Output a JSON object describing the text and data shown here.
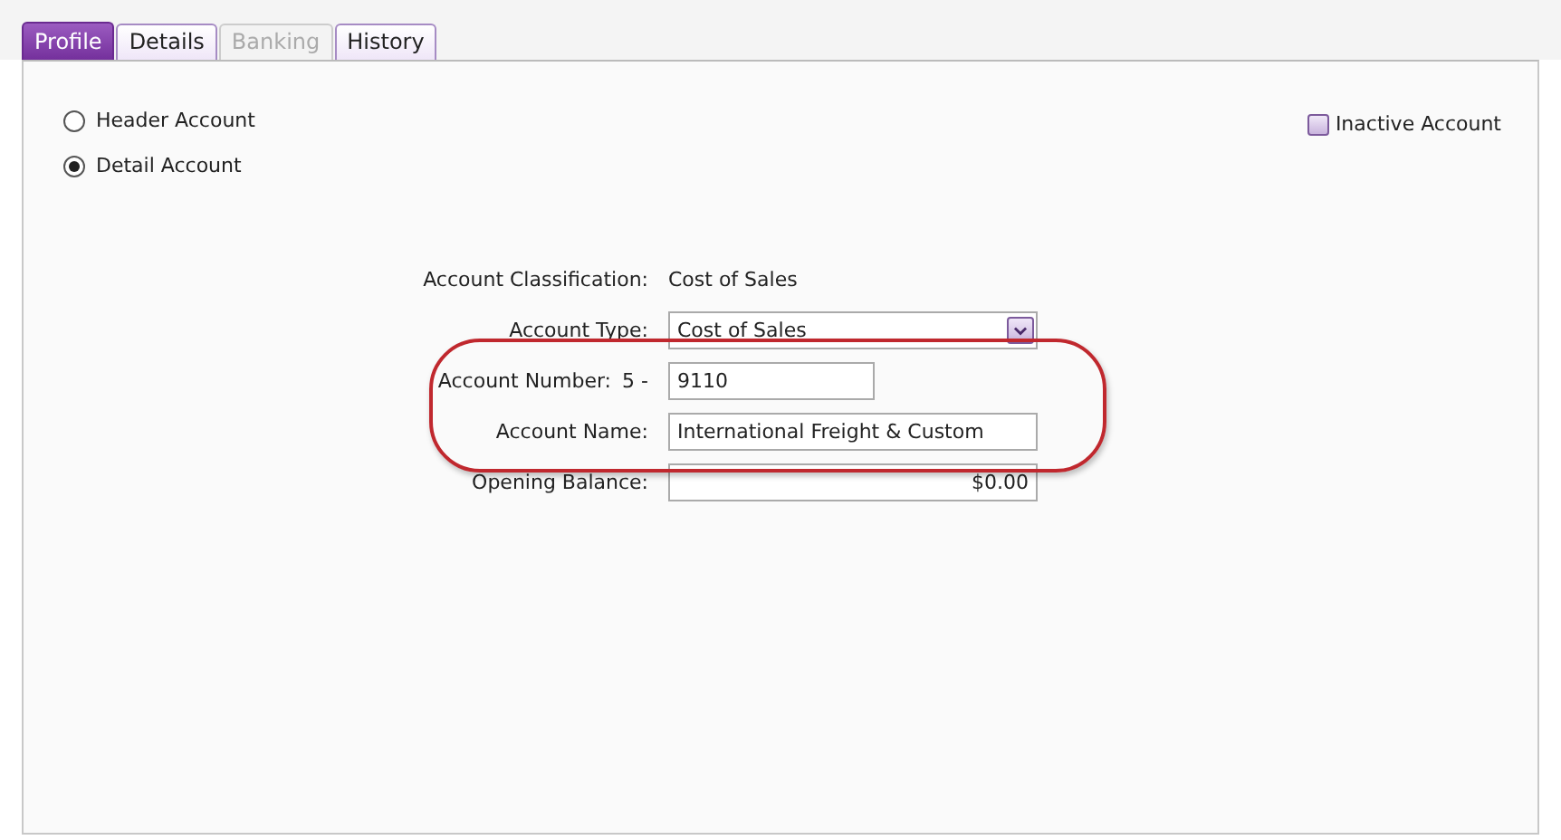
{
  "tabs": [
    {
      "label": "Profile",
      "selected": true,
      "disabled": false
    },
    {
      "label": "Details",
      "selected": false,
      "disabled": false
    },
    {
      "label": "Banking",
      "selected": false,
      "disabled": true
    },
    {
      "label": "History",
      "selected": false,
      "disabled": false
    }
  ],
  "account_level": [
    {
      "label": "Header Account",
      "selected": false
    },
    {
      "label": "Detail Account",
      "selected": true
    }
  ],
  "inactive": {
    "label": "Inactive Account",
    "checked": false
  },
  "form": [
    {
      "kind": "text",
      "label": "Account Classification:",
      "value": "Cost of Sales"
    },
    {
      "kind": "dropdown",
      "label": "Account Type:",
      "value": "Cost of Sales"
    },
    {
      "kind": "number",
      "label": "Account Number:",
      "prefix": "5 -",
      "value": "9110"
    },
    {
      "kind": "input",
      "label": "Account Name:",
      "value": "International Freight & Custom"
    },
    {
      "kind": "amount",
      "label": "Opening Balance:",
      "value": "$0.00"
    }
  ],
  "highlight_outline": {
    "shown": true
  }
}
